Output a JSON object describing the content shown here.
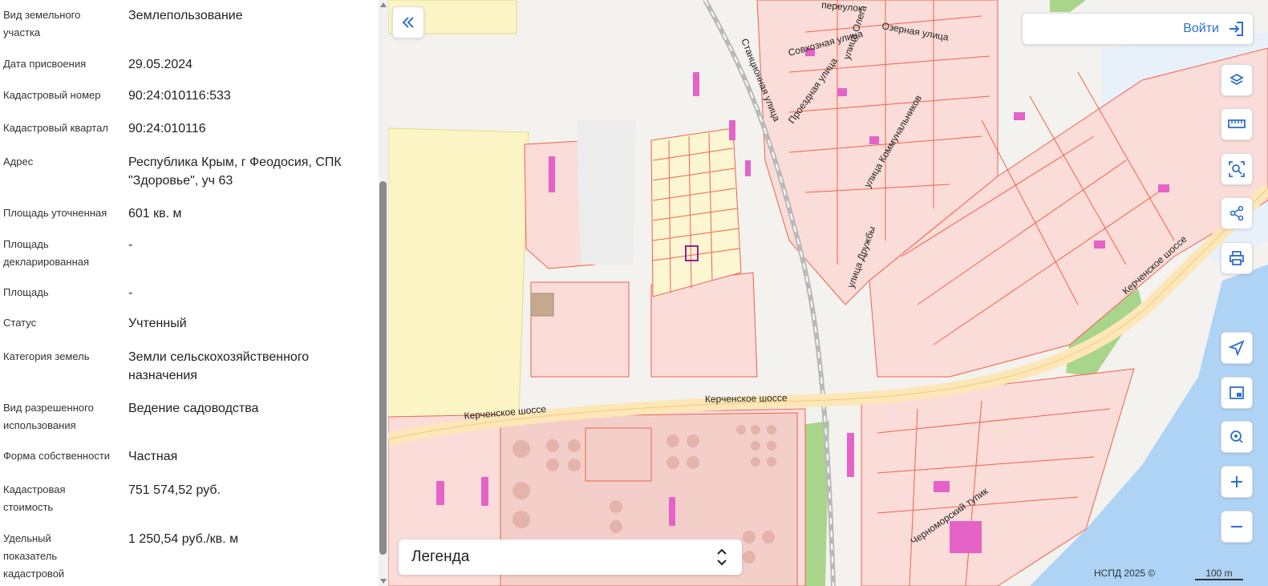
{
  "properties": [
    {
      "label": "Вид земельного участка",
      "value": "Землепользование"
    },
    {
      "label": "Дата присвоения",
      "value": "29.05.2024"
    },
    {
      "label": "Кадастровый номер",
      "value": "90:24:010116:533"
    },
    {
      "label": "Кадастровый квартал",
      "value": "90:24:010116"
    },
    {
      "label": "Адрес",
      "value": "Республика Крым, г Феодосия, СПК \"Здоровье\", уч 63"
    },
    {
      "label": "Площадь уточненная",
      "value": "601 кв. м"
    },
    {
      "label": "Площадь декларированная",
      "value": "-"
    },
    {
      "label": "Площадь",
      "value": "-"
    },
    {
      "label": "Статус",
      "value": "Учтенный"
    },
    {
      "label": "Категория земель",
      "value": "Земли сельскохозяйственного назначения"
    },
    {
      "label": "Вид разрешенного использования",
      "value": "Ведение садоводства"
    },
    {
      "label": "Форма собственности",
      "value": "Частная"
    },
    {
      "label": "Кадастровая стоимость",
      "value": "751 574,52 руб."
    },
    {
      "label": "Удельный показатель кадастровой стоимости",
      "value": "1 250,54 руб./кв. м"
    }
  ],
  "map": {
    "login_label": "Войти",
    "legend_label": "Легенда",
    "copyright": "НСПД 2025 ©",
    "scale_label": "100 m",
    "street_labels": {
      "kerch_1": "Керченское шоссе",
      "kerch_2": "Керченское шоссе",
      "kerch_3": "Керченское шоссе",
      "stantsionnaya": "Станционная улица",
      "sovkhoznaya": "Совхозная улица",
      "proezdnaya": "Проездная улица",
      "ulitsa_olega": "улица Олега",
      "ozernaya": "Озерная улица",
      "pereulok": "переулок",
      "kommunalnikov": "улица Коммунальников",
      "druzhby": "улица Дружбы",
      "chernomorsky": "Черноморский тупик"
    },
    "colors": {
      "parcel_fill": "#fadcd8",
      "parcel_stroke": "#f0624d",
      "building": "#e563c6",
      "yellow_zone": "#fbf4c4",
      "green": "#a9d58b",
      "water": "#aed3f5",
      "road": "#fde7b8",
      "accent": "#2f6fd1",
      "highlight": "#9b1f8c"
    },
    "icons": [
      "double-chevron-left-icon",
      "login-icon",
      "layers-icon",
      "ruler-icon",
      "select-area-icon",
      "share-icon",
      "print-icon",
      "locate-arrow-icon",
      "minimap-icon",
      "geo-search-icon",
      "plus-icon",
      "minus-icon",
      "chevron-updown-icon"
    ]
  }
}
